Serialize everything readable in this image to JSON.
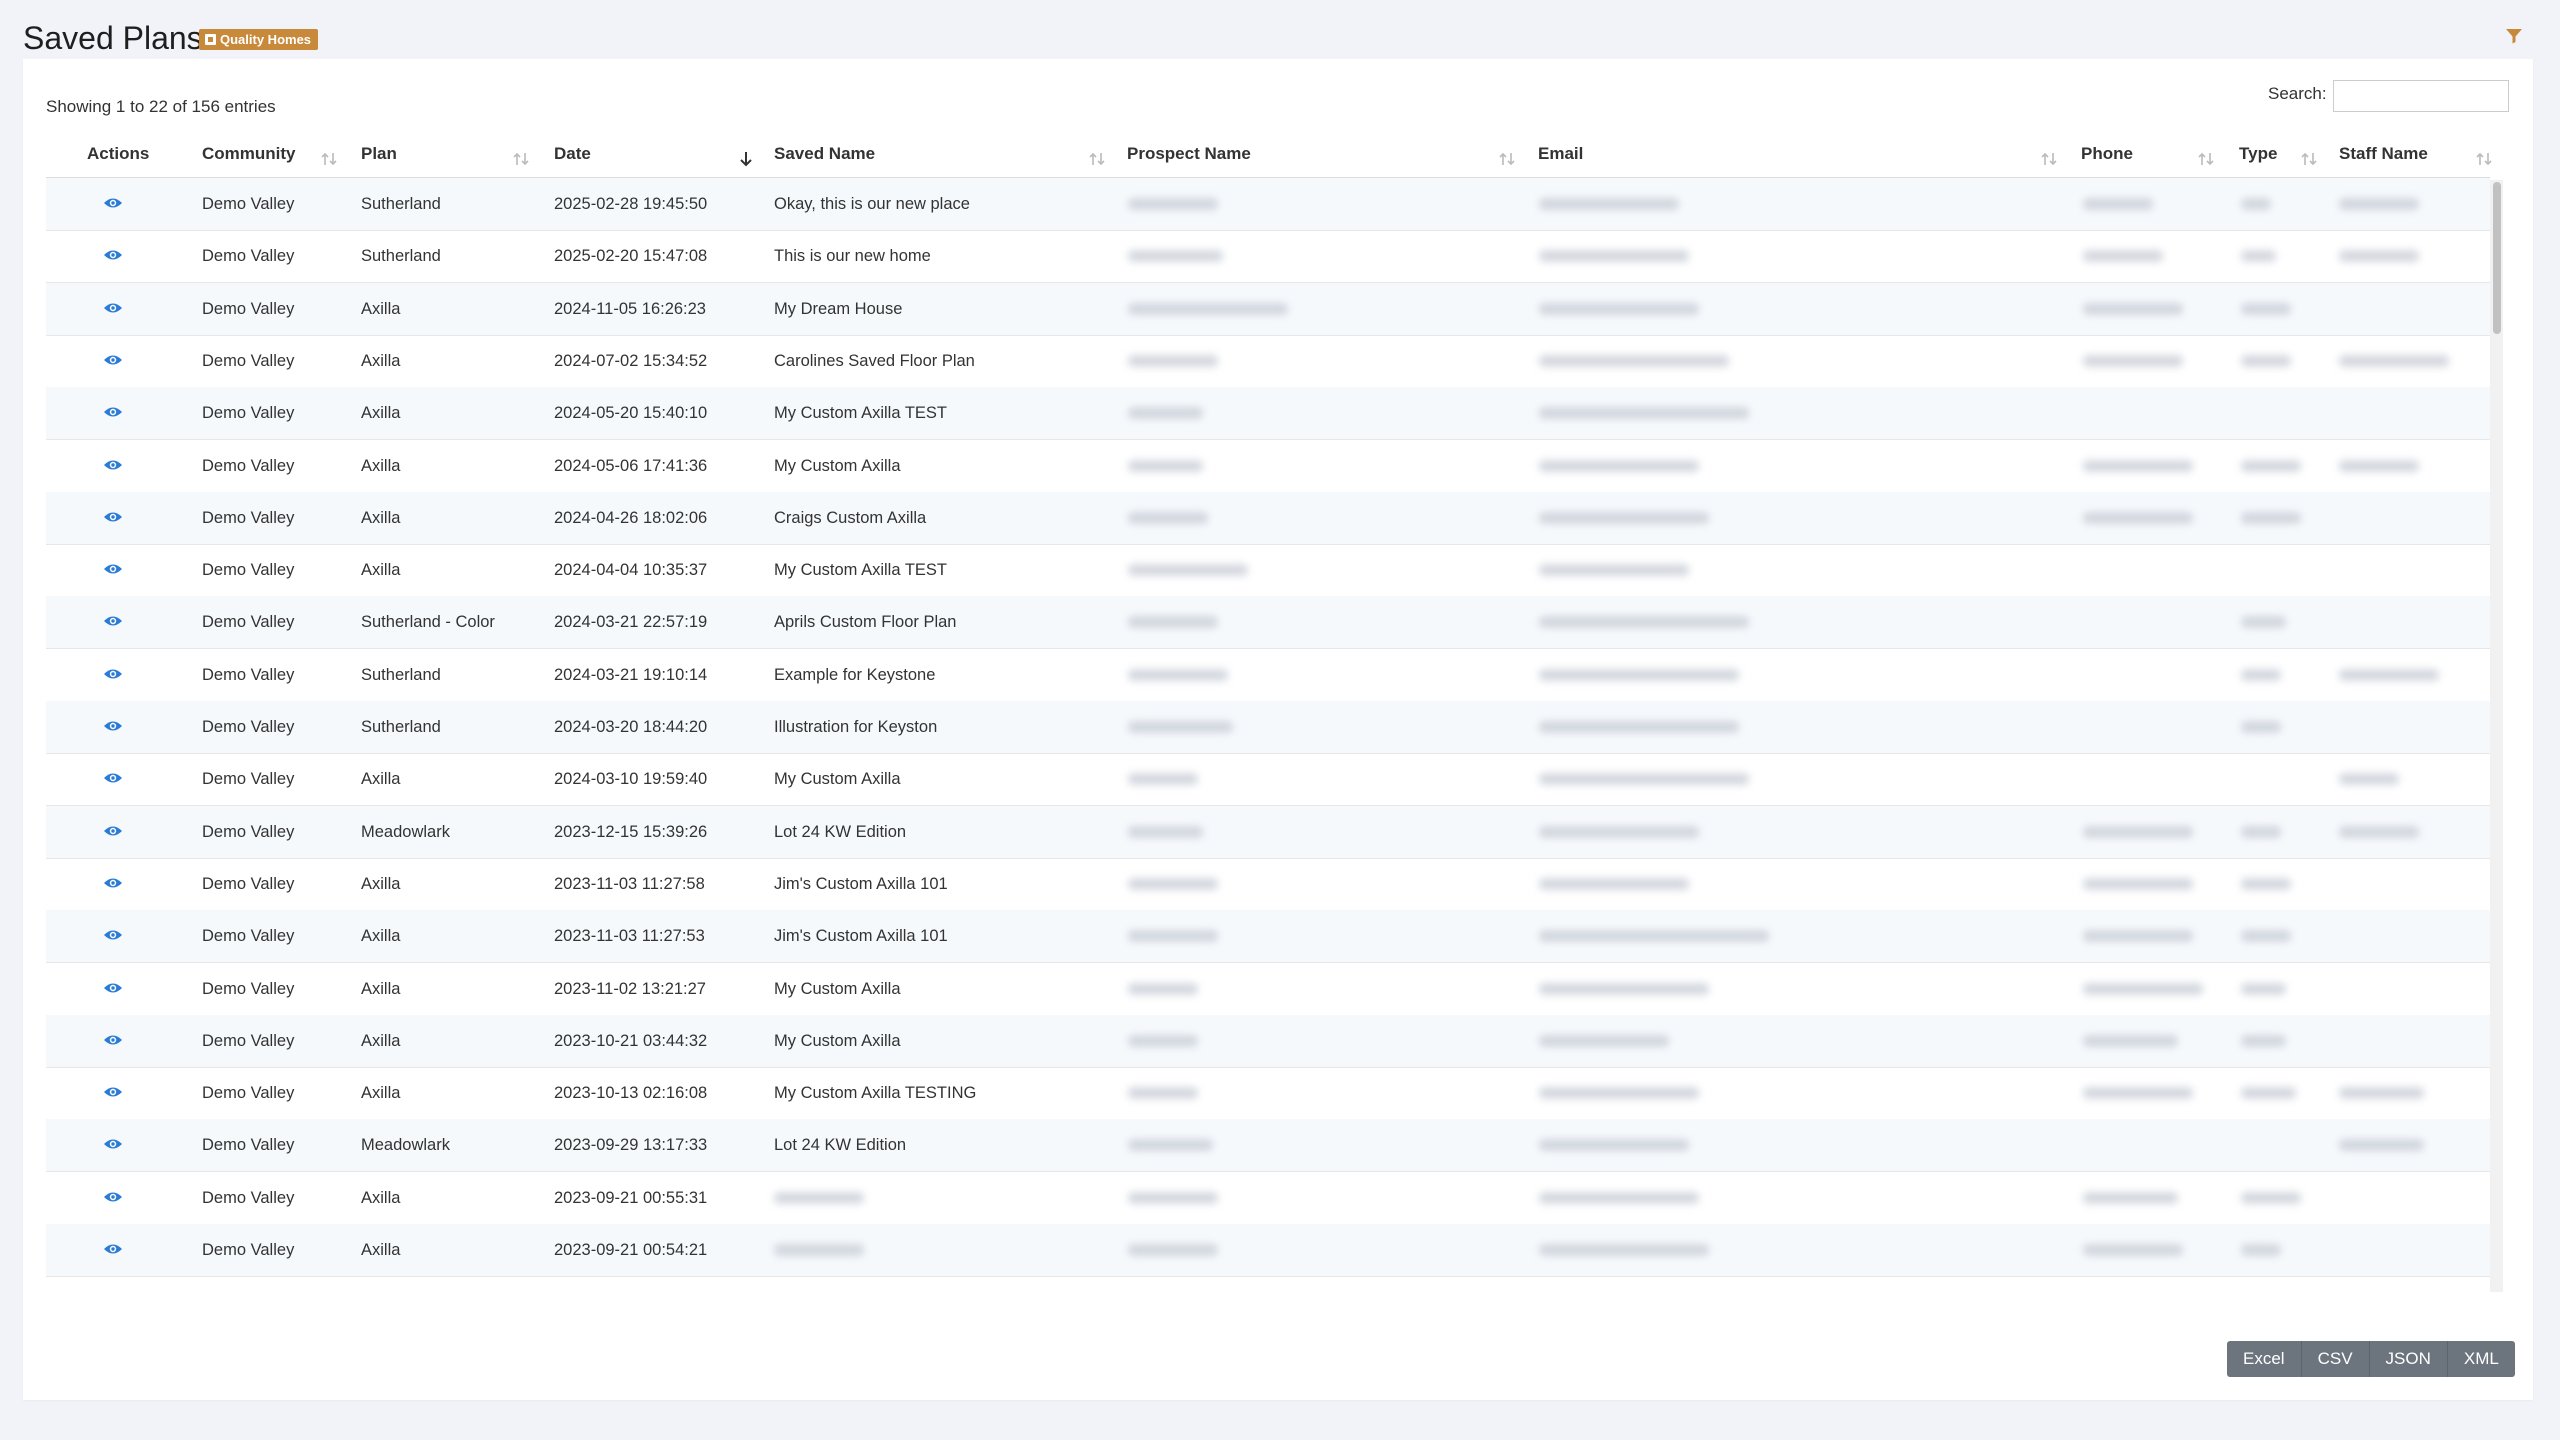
{
  "header": {
    "title": "Saved Plans",
    "badge": "Quality Homes",
    "filter_icon": "filter-icon"
  },
  "table": {
    "search_label": "Search:",
    "search_value": "",
    "info": "Showing 1 to 22 of 156 entries",
    "columns": [
      "Actions",
      "Community",
      "Plan",
      "Date",
      "Saved Name",
      "Prospect Name",
      "Email",
      "Phone",
      "Type",
      "Staff Name"
    ],
    "sorted_column": "Date",
    "sort_direction": "descending",
    "rows": [
      {
        "community": "Demo Valley",
        "plan": "Sutherland",
        "date": "2025-02-28 19:45:50",
        "saved_name": "Okay, this is our new place"
      },
      {
        "community": "Demo Valley",
        "plan": "Sutherland",
        "date": "2025-02-20 15:47:08",
        "saved_name": "This is our new home"
      },
      {
        "community": "Demo Valley",
        "plan": "Axilla",
        "date": "2024-11-05 16:26:23",
        "saved_name": "My Dream House"
      },
      {
        "community": "Demo Valley",
        "plan": "Axilla",
        "date": "2024-07-02 15:34:52",
        "saved_name": "Carolines Saved Floor Plan"
      },
      {
        "community": "Demo Valley",
        "plan": "Axilla",
        "date": "2024-05-20 15:40:10",
        "saved_name": "My Custom Axilla TEST"
      },
      {
        "community": "Demo Valley",
        "plan": "Axilla",
        "date": "2024-05-06 17:41:36",
        "saved_name": "My Custom Axilla"
      },
      {
        "community": "Demo Valley",
        "plan": "Axilla",
        "date": "2024-04-26 18:02:06",
        "saved_name": "Craigs Custom Axilla"
      },
      {
        "community": "Demo Valley",
        "plan": "Axilla",
        "date": "2024-04-04 10:35:37",
        "saved_name": "My Custom Axilla TEST"
      },
      {
        "community": "Demo Valley",
        "plan": "Sutherland - Color",
        "date": "2024-03-21 22:57:19",
        "saved_name": "Aprils Custom Floor Plan"
      },
      {
        "community": "Demo Valley",
        "plan": "Sutherland",
        "date": "2024-03-21 19:10:14",
        "saved_name": "Example for Keystone"
      },
      {
        "community": "Demo Valley",
        "plan": "Sutherland",
        "date": "2024-03-20 18:44:20",
        "saved_name": "Illustration for Keyston"
      },
      {
        "community": "Demo Valley",
        "plan": "Axilla",
        "date": "2024-03-10 19:59:40",
        "saved_name": "My Custom Axilla"
      },
      {
        "community": "Demo Valley",
        "plan": "Meadowlark",
        "date": "2023-12-15 15:39:26",
        "saved_name": "Lot 24 KW Edition"
      },
      {
        "community": "Demo Valley",
        "plan": "Axilla",
        "date": "2023-11-03 11:27:58",
        "saved_name": "Jim's Custom Axilla 101"
      },
      {
        "community": "Demo Valley",
        "plan": "Axilla",
        "date": "2023-11-03 11:27:53",
        "saved_name": "Jim's Custom Axilla 101"
      },
      {
        "community": "Demo Valley",
        "plan": "Axilla",
        "date": "2023-11-02 13:21:27",
        "saved_name": "My Custom Axilla"
      },
      {
        "community": "Demo Valley",
        "plan": "Axilla",
        "date": "2023-10-21 03:44:32",
        "saved_name": "My Custom Axilla"
      },
      {
        "community": "Demo Valley",
        "plan": "Axilla",
        "date": "2023-10-13 02:16:08",
        "saved_name": "My Custom Axilla TESTING"
      },
      {
        "community": "Demo Valley",
        "plan": "Meadowlark",
        "date": "2023-09-29 13:17:33",
        "saved_name": "Lot 24 KW Edition"
      },
      {
        "community": "Demo Valley",
        "plan": "Axilla",
        "date": "2023-09-21 00:55:31",
        "saved_name": ""
      },
      {
        "community": "Demo Valley",
        "plan": "Axilla",
        "date": "2023-09-21 00:54:21",
        "saved_name": ""
      }
    ]
  },
  "export": [
    "Excel",
    "CSV",
    "JSON",
    "XML"
  ],
  "colors": {
    "accent": "#c8893a",
    "eye": "#2a7bd6",
    "export_bg": "#6c757d",
    "stripe": "#f6f9fc"
  }
}
